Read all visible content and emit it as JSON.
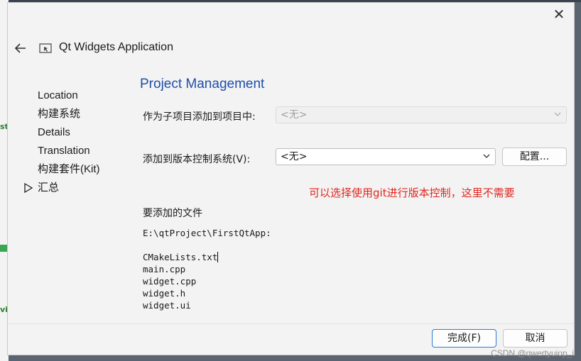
{
  "dialog": {
    "title": "Qt Widgets Application",
    "close_symbol": "✕"
  },
  "nav": {
    "items": [
      {
        "label": "Location"
      },
      {
        "label": "构建系统"
      },
      {
        "label": "Details"
      },
      {
        "label": "Translation"
      },
      {
        "label": "构建套件(Kit)"
      },
      {
        "label": "汇总",
        "current": true
      }
    ]
  },
  "main": {
    "section_title": "Project Management",
    "add_subproject_label": "作为子项目添加到项目中:",
    "add_subproject_value": "<无>",
    "vcs_label": "添加到版本控制系统(V):",
    "vcs_value": "<无>",
    "configure_button": "配置...",
    "annotation": "可以选择使用git进行版本控制，这里不需要",
    "files_heading": "要添加的文件",
    "files_path": "E:\\qtProject\\FirstQtApp:",
    "files": [
      "CMakeLists.txt",
      "main.cpp",
      "widget.cpp",
      "widget.h",
      "widget.ui"
    ]
  },
  "footer": {
    "finish_button": "完成(F)",
    "cancel_button": "取消"
  },
  "watermark": "CSDN @qwertyuiop_i",
  "background": {
    "left_text_1": "st",
    "left_text_2": "vi"
  },
  "colors": {
    "accent": "#1f4fa8",
    "annotation": "#e0261f",
    "primary_border": "#2b7cd3"
  }
}
